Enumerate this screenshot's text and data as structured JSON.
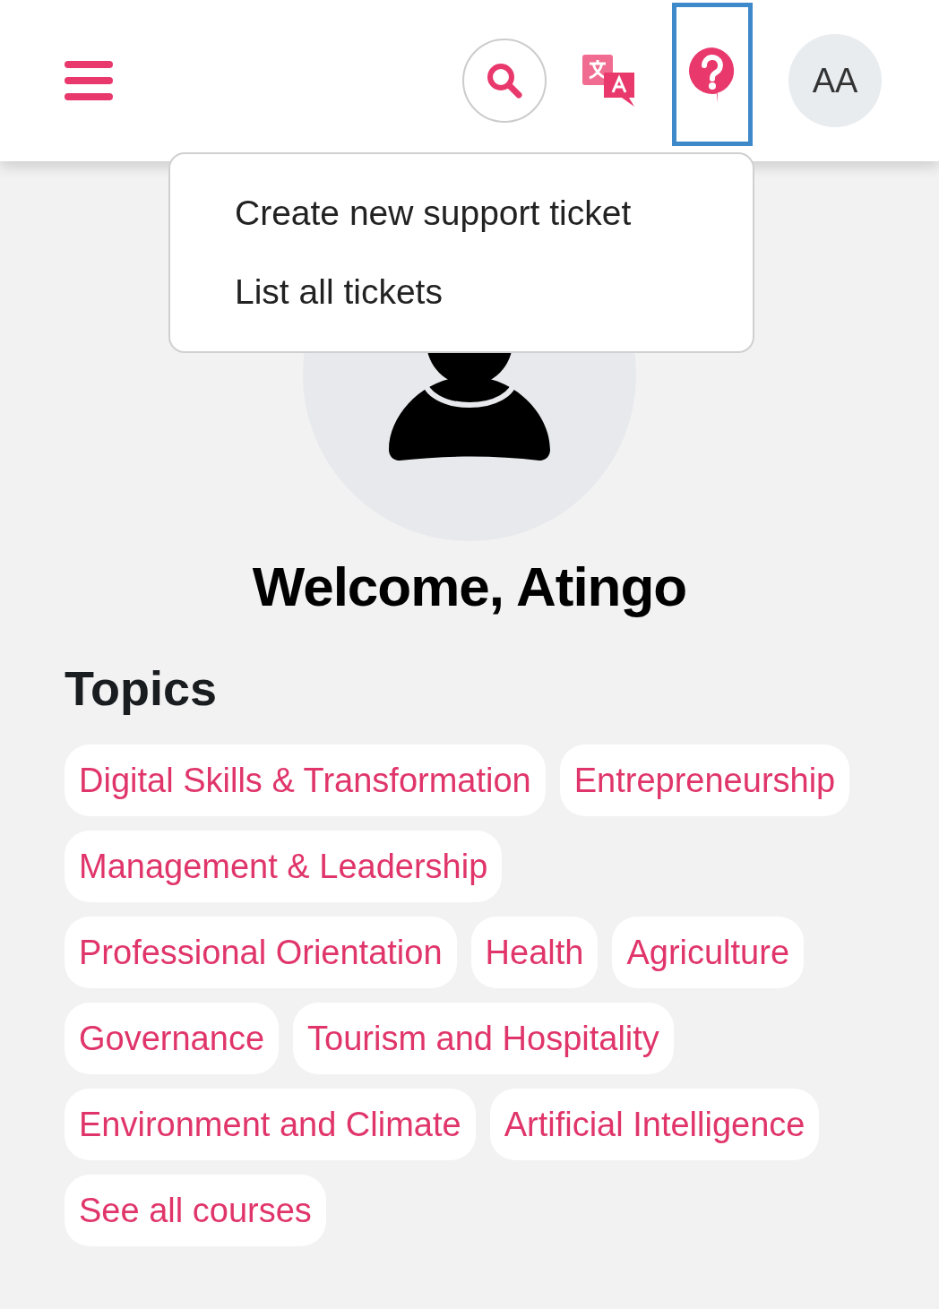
{
  "header": {
    "help_button": {
      "focused": true
    },
    "avatar": {
      "initials": "AA"
    }
  },
  "help_menu": {
    "items": [
      "Create new support ticket",
      "List all tickets"
    ]
  },
  "welcome": "Welcome, Atingo",
  "topics": {
    "title": "Topics",
    "items": [
      "Digital Skills & Transformation",
      "Entrepreneurship",
      "Management & Leadership",
      "Professional Orientation",
      "Health",
      "Agriculture",
      "Governance",
      "Tourism and Hospitality",
      "Environment and Climate",
      "Artificial Intelligence"
    ],
    "see_all": "See all courses"
  }
}
